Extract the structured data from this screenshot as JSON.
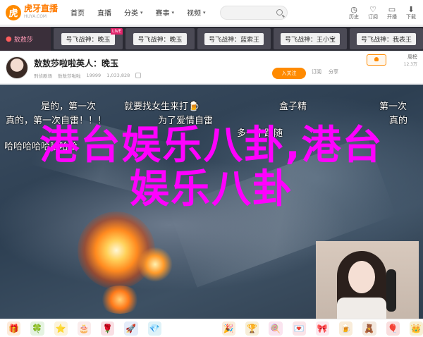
{
  "header": {
    "logo_mark": "虎",
    "logo_text": "虎牙直播",
    "logo_sub": "HUYA.COM",
    "nav": [
      {
        "label": "首页",
        "has_menu": false
      },
      {
        "label": "直播",
        "has_menu": false
      },
      {
        "label": "分类",
        "has_menu": true
      },
      {
        "label": "赛事",
        "has_menu": true
      },
      {
        "label": "视频",
        "has_menu": true
      }
    ],
    "top_icons": [
      {
        "glyph": "◷",
        "label": "历史",
        "icon": "history-icon"
      },
      {
        "glyph": "♡",
        "label": "订阅",
        "icon": "subscribe-icon"
      },
      {
        "glyph": "▭",
        "label": "开播",
        "icon": "broadcast-icon"
      },
      {
        "glyph": "⬇",
        "label": "下载",
        "icon": "download-icon"
      }
    ]
  },
  "room_strip": {
    "current_label": "敖敖莎",
    "rooms": [
      {
        "label": "号飞战神：晚玉",
        "live": "LIVE"
      },
      {
        "label": "号飞战神：晚玉",
        "live": ""
      },
      {
        "label": "号飞战神：蓝索王",
        "live": ""
      },
      {
        "label": "号飞战神：王小宝",
        "live": ""
      },
      {
        "label": "号飞战神：我表王",
        "live": ""
      }
    ]
  },
  "room_info": {
    "title": "敖敖莎啦啦英人：晚玉",
    "meta": [
      "刑侦剧场",
      "敖敖莎啦啦",
      "19999",
      "1,033,828"
    ],
    "follow_label": "入关注",
    "actions": [
      "订阅",
      "分享"
    ],
    "rank_top": "周榜",
    "rank_value": "12.3万"
  },
  "video": {
    "danmu": [
      {
        "text": "是的，第一次"
      },
      {
        "text": "就要找女生来打🍺"
      },
      {
        "text": "盒子精"
      },
      {
        "text": "第一次"
      },
      {
        "text": "真的，第一次自雷！！！"
      },
      {
        "text": "为了爱情自雷"
      },
      {
        "text": "真的"
      },
      {
        "text": "多一个跟随"
      },
      {
        "text": "哈哈哈哈哈哈哈哈"
      }
    ],
    "overlay_line1": "港台娱乐八卦,港台",
    "overlay_line2": "娱乐八卦",
    "overlay_color": "#ff00ff"
  },
  "gift_bar": {
    "gifts": [
      {
        "glyph": "🎁",
        "color": "#f39c4a"
      },
      {
        "glyph": "🍀",
        "color": "#7cc16b"
      },
      {
        "glyph": "⭐",
        "color": "#f0c14b"
      },
      {
        "glyph": "🎂",
        "color": "#e8a0a0"
      },
      {
        "glyph": "🌹",
        "color": "#e0607a"
      },
      {
        "glyph": "🚀",
        "color": "#7aa0e0"
      },
      {
        "glyph": "💎",
        "color": "#5bc0de"
      },
      {
        "glyph": "🎉",
        "color": "#e8a24a"
      },
      {
        "glyph": "🏆",
        "color": "#d8a93a"
      },
      {
        "glyph": "🍭",
        "color": "#e57ab0"
      },
      {
        "glyph": "💌",
        "color": "#e87a8a"
      },
      {
        "glyph": "🎀",
        "color": "#f08fb0"
      },
      {
        "glyph": "🍺",
        "color": "#e0a040"
      },
      {
        "glyph": "🧸",
        "color": "#c58b5a"
      },
      {
        "glyph": "🎈",
        "color": "#e05a5a"
      },
      {
        "glyph": "👑",
        "color": "#d8b02a"
      }
    ]
  }
}
